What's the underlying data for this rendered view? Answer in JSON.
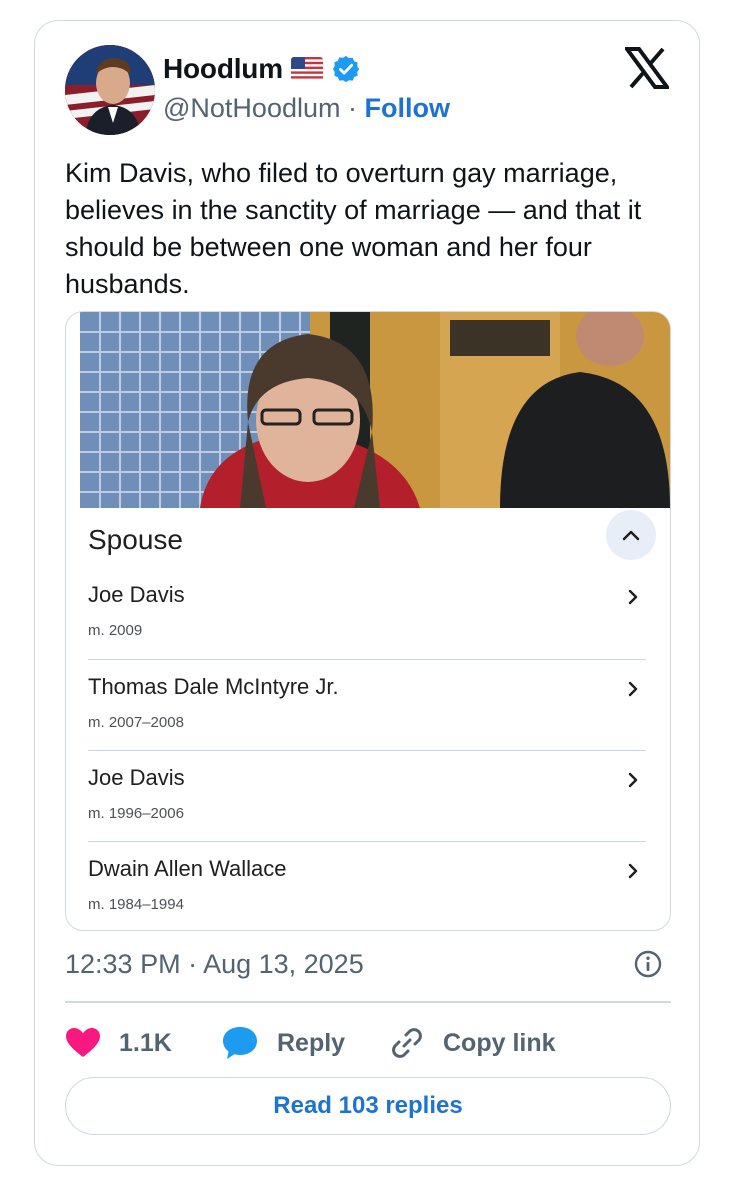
{
  "user": {
    "display_name": "Hoodlum",
    "handle": "@NotHoodlum",
    "separator": "·",
    "follow_label": "Follow",
    "verified_color": "#1d9bf0"
  },
  "icons": {
    "flag": "us-flag-icon",
    "verified": "verified-badge-icon",
    "brand": "x-logo-icon",
    "info": "info-icon",
    "like": "heart-icon",
    "reply": "speech-bubble-icon",
    "copy": "link-icon"
  },
  "tweet": {
    "text": "Kim Davis, who filed to overturn gay marriage, believes in the sanctity of marriage — and that it should be between one woman and her four husbands.",
    "timestamp": "12:33 PM · Aug 13, 2025"
  },
  "embed": {
    "section_title": "Spouse",
    "spouses": [
      {
        "name": "Joe Davis",
        "years": "m. 2009"
      },
      {
        "name": "Thomas Dale McIntyre Jr.",
        "years": "m. 2007–2008"
      },
      {
        "name": "Joe Davis",
        "years": "m. 1996–2006"
      },
      {
        "name": "Dwain Allen Wallace",
        "years": "m. 1984–1994"
      }
    ]
  },
  "actions": {
    "like_count": "1.1K",
    "reply_label": "Reply",
    "copy_label": "Copy link",
    "read_replies_label": "Read 103 replies"
  },
  "colors": {
    "accent": "#1d73d1",
    "like": "#f91880",
    "muted": "#536471"
  }
}
